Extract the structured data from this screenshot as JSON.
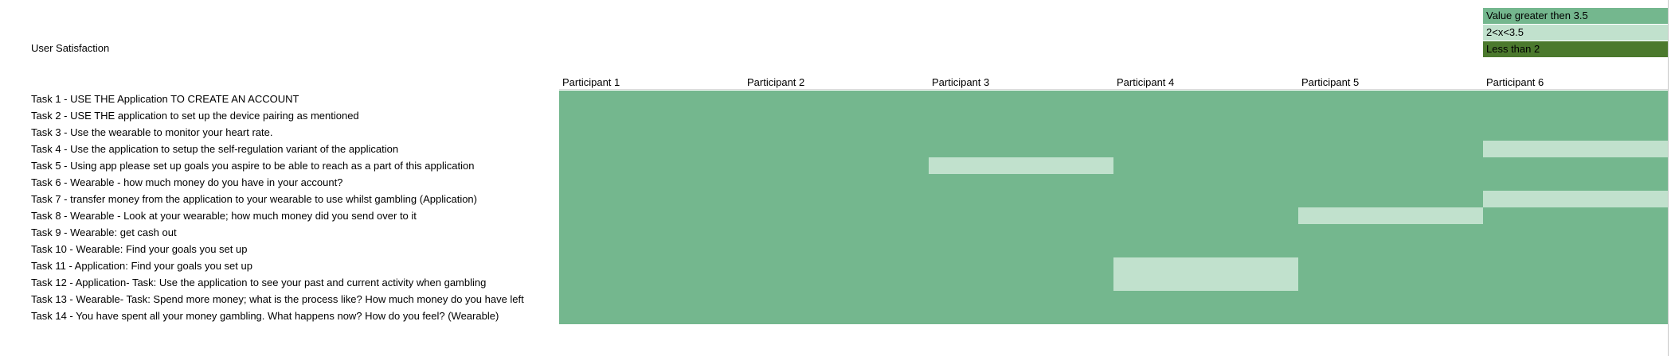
{
  "legend": [
    {
      "label": "Value greater then 3.5",
      "color": "#74b78e"
    },
    {
      "label": "2<x<3.5",
      "color": "#c1e1cd"
    },
    {
      "label": "Less than 2",
      "color": "#4b792d"
    }
  ],
  "chart_data": {
    "type": "heatmap",
    "title": "User Satisfaction",
    "columns": [
      "Participant 1",
      "Participant 2",
      "Participant 3",
      "Participant 4",
      "Participant 5",
      "Participant 6"
    ],
    "rows": [
      "Task 1 - USE THE Application TO CREATE AN ACCOUNT",
      "Task 2 - USE THE application to set up the device pairing as mentioned",
      "Task 3 - Use the wearable to monitor your heart rate.",
      "Task 4 - Use the application to setup the self-regulation variant of the application",
      "Task 5 - Using app please set up goals you aspire to be able to reach as a part of this application",
      "Task 6 - Wearable - how much money do you have in your account?",
      "Task 7 - transfer money from the application to your wearable to use whilst gambling (Application)",
      "Task 8 - Wearable - Look at your wearable; how much money did you send over to it",
      "Task 9 - Wearable: get cash out",
      "Task 10 - Wearable: Find your goals you set up",
      "Task 11 - Application: Find your goals you set up",
      "Task 12 - Application- Task: Use the application to see your past and current activity when gambling",
      "Task 13 - Wearable- Task: Spend more money; what is the process like? How much money do you have left",
      "Task 14 - You have spent all your money gambling. What happens now? How do you feel? (Wearable)"
    ],
    "categories": [
      "Value greater then 3.5",
      "2<x<3.5",
      "Less than 2"
    ],
    "cells": [
      [
        "Value greater then 3.5",
        "Value greater then 3.5",
        "Value greater then 3.5",
        "Value greater then 3.5",
        "Value greater then 3.5",
        "Value greater then 3.5"
      ],
      [
        "Value greater then 3.5",
        "Value greater then 3.5",
        "Value greater then 3.5",
        "Value greater then 3.5",
        "Value greater then 3.5",
        "Value greater then 3.5"
      ],
      [
        "Value greater then 3.5",
        "Value greater then 3.5",
        "Value greater then 3.5",
        "Value greater then 3.5",
        "Value greater then 3.5",
        "Value greater then 3.5"
      ],
      [
        "Value greater then 3.5",
        "Value greater then 3.5",
        "Value greater then 3.5",
        "Value greater then 3.5",
        "Value greater then 3.5",
        "2<x<3.5"
      ],
      [
        "Value greater then 3.5",
        "Value greater then 3.5",
        "2<x<3.5",
        "Value greater then 3.5",
        "Value greater then 3.5",
        "Value greater then 3.5"
      ],
      [
        "Value greater then 3.5",
        "Value greater then 3.5",
        "Value greater then 3.5",
        "Value greater then 3.5",
        "Value greater then 3.5",
        "Value greater then 3.5"
      ],
      [
        "Value greater then 3.5",
        "Value greater then 3.5",
        "Value greater then 3.5",
        "Value greater then 3.5",
        "Value greater then 3.5",
        "2<x<3.5"
      ],
      [
        "Value greater then 3.5",
        "Value greater then 3.5",
        "Value greater then 3.5",
        "Value greater then 3.5",
        "2<x<3.5",
        "Value greater then 3.5"
      ],
      [
        "Value greater then 3.5",
        "Value greater then 3.5",
        "Value greater then 3.5",
        "Value greater then 3.5",
        "Value greater then 3.5",
        "Value greater then 3.5"
      ],
      [
        "Value greater then 3.5",
        "Value greater then 3.5",
        "Value greater then 3.5",
        "Value greater then 3.5",
        "Value greater then 3.5",
        "Value greater then 3.5"
      ],
      [
        "Value greater then 3.5",
        "Value greater then 3.5",
        "Value greater then 3.5",
        "2<x<3.5",
        "Value greater then 3.5",
        "Value greater then 3.5"
      ],
      [
        "Value greater then 3.5",
        "Value greater then 3.5",
        "Value greater then 3.5",
        "2<x<3.5",
        "Value greater then 3.5",
        "Value greater then 3.5"
      ],
      [
        "Value greater then 3.5",
        "Value greater then 3.5",
        "Value greater then 3.5",
        "Value greater then 3.5",
        "Value greater then 3.5",
        "Value greater then 3.5"
      ],
      [
        "Value greater then 3.5",
        "Value greater then 3.5",
        "Value greater then 3.5",
        "Value greater then 3.5",
        "Value greater then 3.5",
        "Value greater then 3.5"
      ]
    ]
  }
}
